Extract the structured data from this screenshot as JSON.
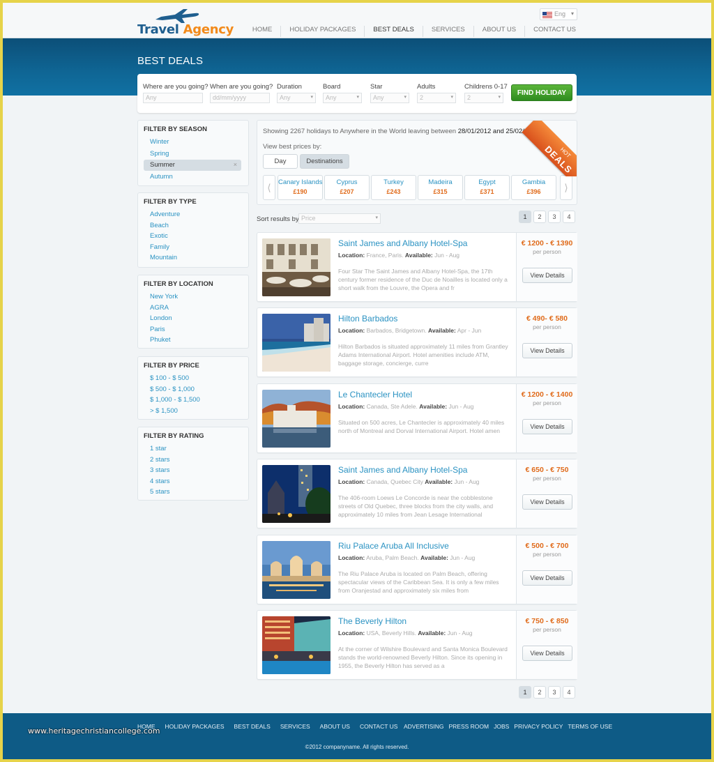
{
  "header": {
    "logo_word1": "Travel",
    "logo_word2": "Agency",
    "language": "Eng",
    "nav": [
      "HOME",
      "HOLIDAY PACKAGES",
      "BEST DEALS",
      "SERVICES",
      "ABOUT US",
      "CONTACT US"
    ],
    "active_nav": "BEST DEALS"
  },
  "banner": {
    "title": "BEST DEALS"
  },
  "search": {
    "where_label": "Where are you going?",
    "where_placeholder": "Any",
    "when_label": "When are you going?",
    "when_placeholder": "dd/mm/yyyy",
    "duration_label": "Duration",
    "duration_value": "Any",
    "board_label": "Board",
    "board_value": "Any",
    "star_label": "Star",
    "star_value": "Any",
    "adults_label": "Adults",
    "adults_value": "2",
    "children_label": "Childrens 0-17",
    "children_value": "2",
    "find_button": "FIND HOLIDAY"
  },
  "filters": [
    {
      "title": "FILTER BY SEASON",
      "items": [
        "Winter",
        "Spring",
        "Summer",
        "Autumn"
      ],
      "selected": "Summer"
    },
    {
      "title": "FILTER BY TYPE",
      "items": [
        "Adventure",
        "Beach",
        "Exotic",
        "Family",
        "Mountain"
      ]
    },
    {
      "title": "FILTER BY LOCATION",
      "items": [
        "New York",
        "AGRA",
        "London",
        "Paris",
        "Phuket"
      ]
    },
    {
      "title": "FILTER BY PRICE",
      "items": [
        "$ 100 - $ 500",
        "$ 500 - $ 1,000",
        "$ 1,000 - $ 1,500",
        "> $ 1,500"
      ]
    },
    {
      "title": "FILTER BY RATING",
      "items": [
        "1 star",
        "2 stars",
        "3 stars",
        "4 stars",
        "5 stars"
      ]
    }
  ],
  "results": {
    "showing_prefix": "Showing 2267 holidays to Anywhere in the World leaving between",
    "date_from": "28/01/2012",
    "and_word": "and",
    "date_to": "25/02/2012",
    "view_prices_label": "View best prices by:",
    "toggle_day": "Day",
    "toggle_destinations": "Destinations",
    "ribbon_small": "HOT",
    "ribbon_big": "DEALS",
    "destinations": [
      {
        "name": "Canary Islands",
        "price": "£190"
      },
      {
        "name": "Cyprus",
        "price": "£207"
      },
      {
        "name": "Turkey",
        "price": "£243"
      },
      {
        "name": "Madeira",
        "price": "£315"
      },
      {
        "name": "Egypt",
        "price": "£371"
      },
      {
        "name": "Gambia",
        "price": "£396"
      }
    ],
    "sort_label": "Sort results by",
    "sort_placeholder": "Price",
    "pages": [
      "1",
      "2",
      "3",
      "4"
    ],
    "current_page": "1"
  },
  "hotels": [
    {
      "name": "Saint James and Albany Hotel-Spa",
      "location_label": "Location:",
      "location": "France, Paris.",
      "available_label": "Available:",
      "available": "Jun - Aug",
      "desc": "Four Star The Saint James and Albany Hotel-Spa, the 17th century former residence of the Duc de Noailles is located only a short walk from the Louvre, the Opera and fr",
      "price": "€ 1200 - € 1390",
      "per": "per person",
      "button": "View Details",
      "image": "paris-courtyard"
    },
    {
      "name": "Hilton Barbados",
      "location_label": "Location:",
      "location": "Barbados, Bridgetown.",
      "available_label": "Available:",
      "available": "Apr - Jun",
      "desc": "Hilton Barbados is situated approximately 11 miles from Grantley Adams International Airport. Hotel amenities include ATM, baggage storage, concierge, curre",
      "price": "€ 490- € 580",
      "per": "per person",
      "button": "View Details",
      "image": "beach-resort"
    },
    {
      "name": "Le Chantecler Hotel",
      "location_label": "Location:",
      "location": "Canada, Ste Adele.",
      "available_label": "Available:",
      "available": "Jun - Aug",
      "desc": "Situated on 500 acres, Le Chantecler is approximately 40 miles north of Montreal and Dorval International Airport. Hotel amen",
      "price": "€ 1200 - € 1400",
      "per": "per person",
      "button": "View Details",
      "image": "lake-hotel"
    },
    {
      "name": "Saint James and Albany Hotel-Spa",
      "location_label": "Location:",
      "location": "Canada, Quebec City",
      "available_label": "Available:",
      "available": "Jun - Aug",
      "desc": "The 406-room Loews Le Concorde is near the cobblestone streets of Old Quebec, three blocks from the city walls, and approximately 10 miles from Jean Lesage International",
      "price": "€ 650 - € 750",
      "per": "per person",
      "button": "View Details",
      "image": "night-city"
    },
    {
      "name": "Riu Palace Aruba All Inclusive",
      "location_label": "Location:",
      "location": "Aruba, Palm Beach.",
      "available_label": "Available:",
      "available": "Jun - Aug",
      "desc": "The Riu Palace Aruba is located on Palm Beach, offering spectacular views of the Caribbean Sea. It is only a few miles from Oranjestad and approximately six miles from",
      "price": "€ 500 - € 700",
      "per": "per person",
      "button": "View Details",
      "image": "palace-dusk"
    },
    {
      "name": "The Beverly Hilton",
      "location_label": "Location:",
      "location": "USA, Beverly Hills.",
      "available_label": "Available:",
      "available": "Jun - Aug",
      "desc": "At the corner of Wilshire Boulevard and Santa Monica Boulevard stands the world-renowned Beverly Hilton. Since its opening in 1955, the Beverly Hilton has served as a",
      "price": "€ 750 - € 850",
      "per": "per person",
      "button": "View Details",
      "image": "pool-night"
    }
  ],
  "footer": {
    "left_links": [
      "HOME",
      "HOLIDAY PACKAGES",
      "BEST DEALS",
      "SERVICES",
      "ABOUT US",
      "CONTACT US"
    ],
    "right_links": [
      "ADVERTISING",
      "PRESS ROOM",
      "JOBS",
      "PRIVACY POLICY",
      "TERMS OF USE"
    ],
    "copyright": "©2012 companyname. All rights reserved."
  },
  "watermark": "www.heritagechristiancollege.com",
  "colors": {
    "brand_blue": "#0f6695",
    "link_blue": "#2a92c2",
    "price_orange": "#e06b1b",
    "find_green": "#3d9b29"
  }
}
